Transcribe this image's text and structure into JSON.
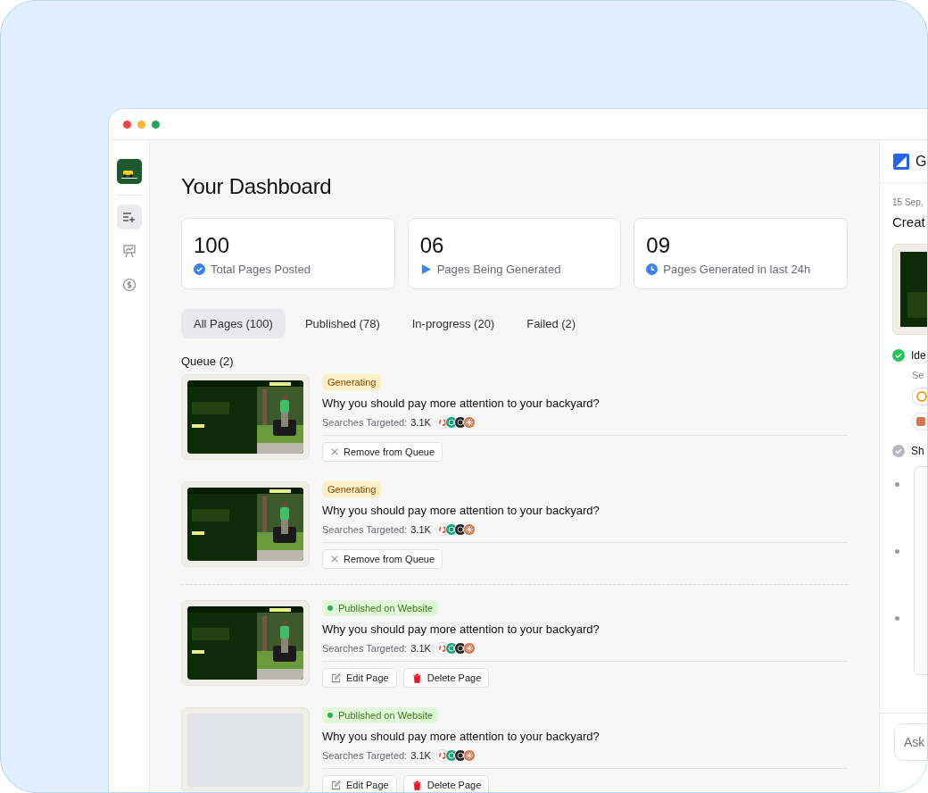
{
  "nav": [
    {
      "kind": "list-add",
      "selected": true
    },
    {
      "kind": "chart",
      "selected": false
    },
    {
      "kind": "dollar",
      "selected": false
    }
  ],
  "title": "Your Dashboard",
  "stats": [
    {
      "kind": "check",
      "value": "100",
      "label": "Total Pages Posted"
    },
    {
      "kind": "play",
      "value": "06",
      "label": "Pages Being Generated"
    },
    {
      "kind": "clock",
      "value": "09",
      "label": "Pages Generated in last 24h"
    }
  ],
  "tabs": [
    {
      "label": "All Pages (100)",
      "selected": true
    },
    {
      "label": "Published (78)",
      "selected": false
    },
    {
      "label": "In-progress (20)",
      "selected": false
    },
    {
      "label": "Failed (2)",
      "selected": false
    }
  ],
  "queue_label": "Queue (2)",
  "groups": [
    {
      "items": [
        {
          "preview": true,
          "kind": "generating",
          "status": "Generating",
          "title": "Why you should pay more attention to your backyard?",
          "searches_label": "Searches Targeted:",
          "searches": "3.1K",
          "actions": [
            {
              "kind": "remove",
              "label": "Remove from Queue"
            }
          ]
        },
        {
          "preview": true,
          "kind": "generating",
          "status": "Generating",
          "title": "Why you should pay more attention to your backyard?",
          "searches_label": "Searches Targeted:",
          "searches": "3.1K",
          "actions": [
            {
              "kind": "remove",
              "label": "Remove from Queue"
            }
          ]
        }
      ]
    },
    {
      "items": [
        {
          "preview": true,
          "kind": "published",
          "status": "Published on Website",
          "title": "Why you should pay more attention to your backyard?",
          "searches_label": "Searches Targeted:",
          "searches": "3.1K",
          "actions": [
            {
              "kind": "edit",
              "label": "Edit Page"
            },
            {
              "kind": "delete",
              "label": "Delete Page"
            }
          ]
        },
        {
          "preview": false,
          "kind": "published",
          "status": "Published on Website",
          "title": "Why you should pay more attention to your backyard?",
          "searches_label": "Searches Targeted:",
          "searches": "3.1K",
          "actions": [
            {
              "kind": "edit",
              "label": "Edit Page"
            },
            {
              "kind": "delete",
              "label": "Delete Page"
            }
          ]
        }
      ]
    }
  ],
  "side_panel": {
    "title": "G",
    "date": "15 Sep,",
    "heading": "Creat",
    "steps": [
      {
        "label": "Ide",
        "done": true,
        "note": "Se"
      },
      {
        "label": "Sh",
        "done": false
      }
    ],
    "ask_placeholder": "Ask"
  }
}
